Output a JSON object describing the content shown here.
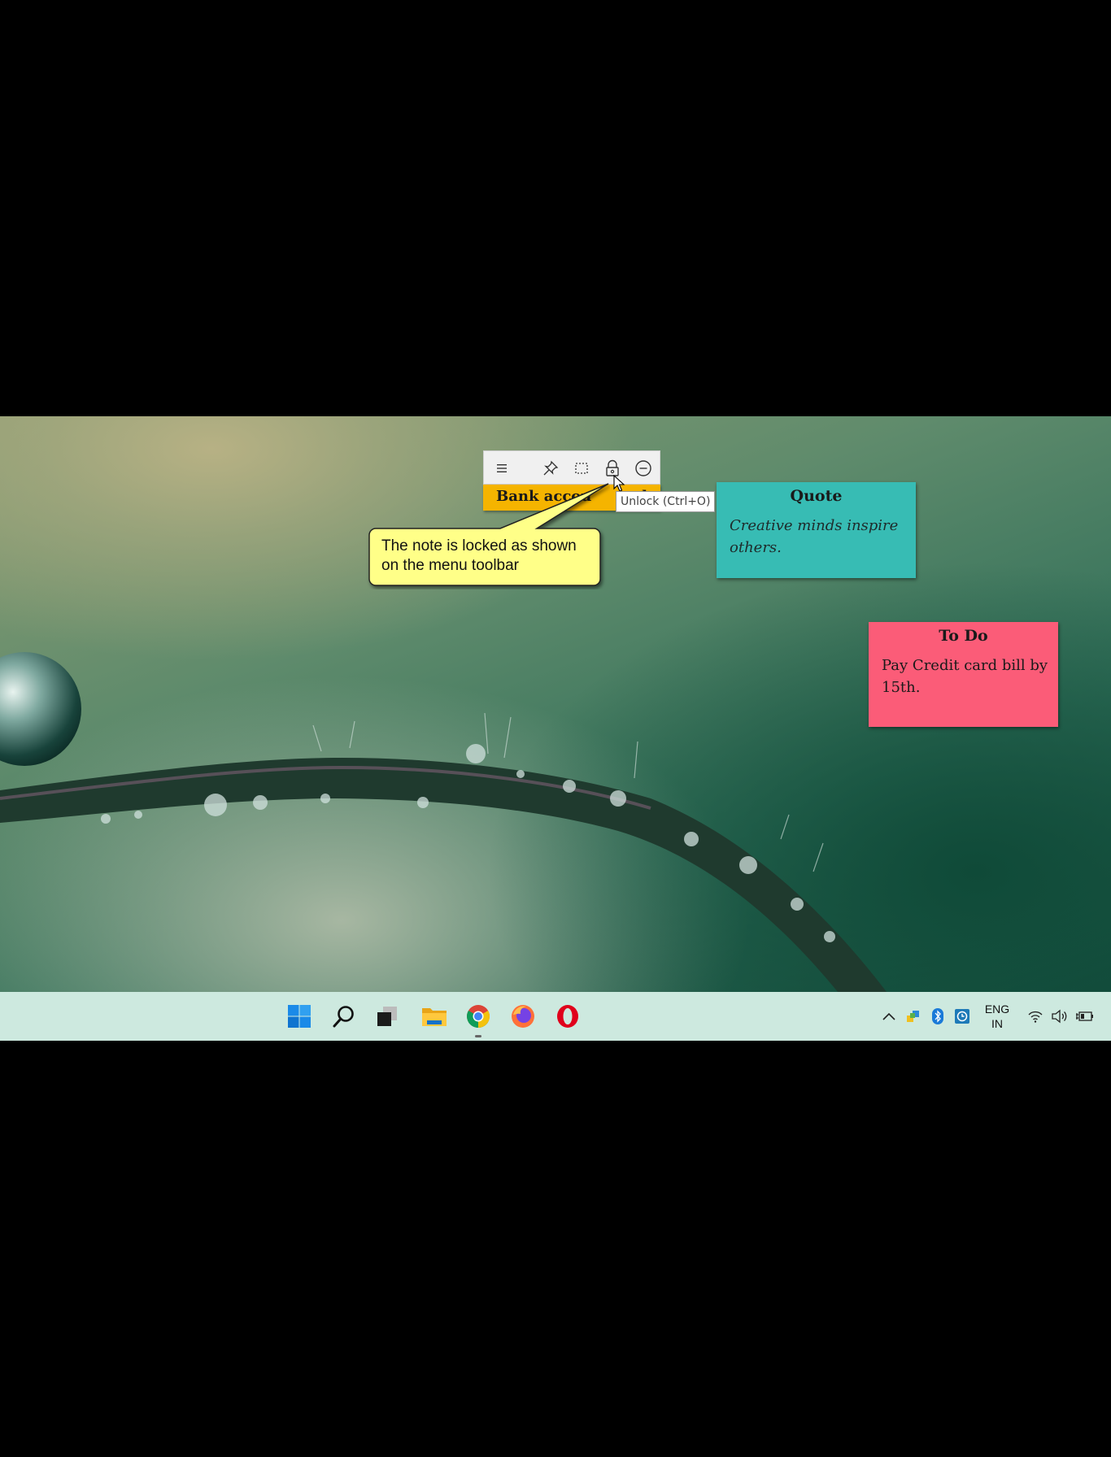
{
  "desktop": {
    "sticky_notes": [
      {
        "id": "bank",
        "title": "Bank accou",
        "title_tail": "de",
        "color": "#f5b400",
        "toolbar": {
          "menu_icon": "hamburger-menu-icon",
          "pin_icon": "pin-icon",
          "select_icon": "select-icon",
          "lock_icon": "lock-icon",
          "minimize_icon": "minimize-icon"
        }
      },
      {
        "id": "quote",
        "title": "Quote",
        "body_line1": "Creative minds inspire",
        "body_line2": "others.",
        "color": "#37bcb4"
      },
      {
        "id": "todo",
        "title": "To Do",
        "body_line1": "Pay Credit card bill by",
        "body_line2": "15th.",
        "color": "#fb5c78"
      }
    ],
    "tooltip": "Unlock (Ctrl+O)",
    "callout": {
      "line1": "The note is locked as shown",
      "line2": "on the menu toolbar",
      "color": "#ffff88"
    }
  },
  "taskbar": {
    "apps": [
      "windows-start-icon",
      "search-icon",
      "task-view-icon",
      "file-explorer-icon",
      "chrome-icon",
      "firefox-icon",
      "opera-icon"
    ],
    "tray": {
      "language_line1": "ENG",
      "language_line2": "IN"
    }
  }
}
